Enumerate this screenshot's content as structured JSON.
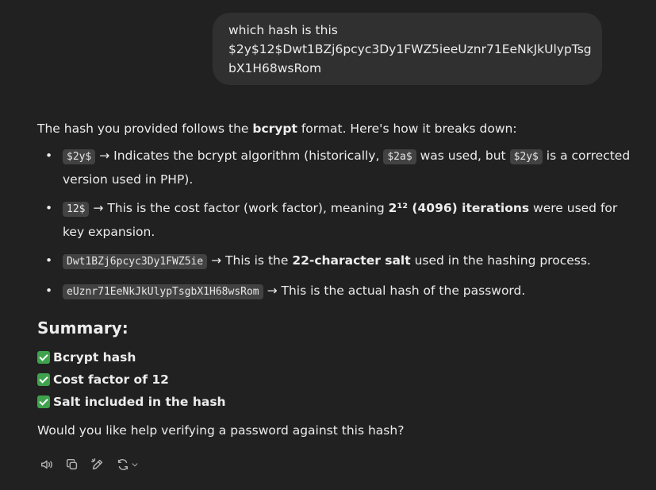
{
  "user_message": {
    "line1": "which hash is this",
    "hash": "$2y$12$Dwt1BZj6pcyc3Dy1FWZ5ieeUznr71EeNkJkUlypTsgbX1H68wsRom"
  },
  "answer": {
    "intro_pre": "The hash you provided follows the ",
    "intro_bold": "bcrypt",
    "intro_post": " format. Here's how it breaks down:",
    "bullets": [
      {
        "code": "$2y$",
        "text_a": " → Indicates the bcrypt algorithm (historically, ",
        "code2": "$2a$",
        "text_b": " was used, but ",
        "code3": "$2y$",
        "text_c": " is a corrected version used in PHP)."
      },
      {
        "code": "12$",
        "text_a": " → This is the cost factor (work factor), meaning ",
        "bold": "2¹² (4096) iterations",
        "text_b": " were used for key expansion."
      },
      {
        "code": "Dwt1BZj6pcyc3Dy1FWZ5ie",
        "text_a": " → This is the ",
        "bold": "22-character salt",
        "text_b": " used in the hashing process."
      },
      {
        "code": "eUznr71EeNkJkUlypTsgbX1H68wsRom",
        "text_a": " → This is the actual hash of the password."
      }
    ],
    "summary_heading": "Summary:",
    "summary_items": [
      "Bcrypt hash",
      "Cost factor of 12",
      "Salt included in the hash"
    ],
    "closing": "Would you like help verifying a password against this hash?"
  },
  "actions": {
    "icons": [
      "speaker-icon",
      "copy-icon",
      "edit-icon",
      "regenerate-icon"
    ]
  }
}
